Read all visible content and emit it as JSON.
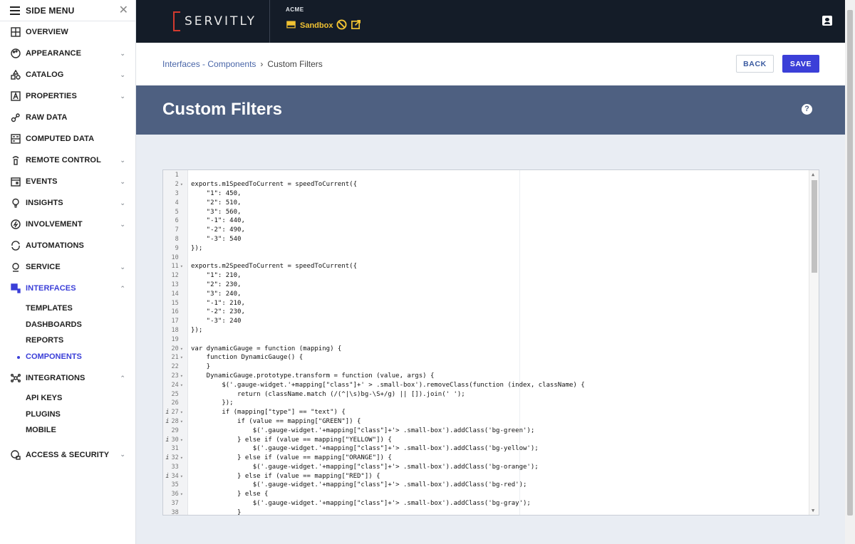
{
  "sidebar": {
    "title": "SIDE MENU",
    "close": "✕",
    "items": [
      {
        "label": "OVERVIEW",
        "chevron": ""
      },
      {
        "label": "APPEARANCE",
        "chevron": "⌄"
      },
      {
        "label": "CATALOG",
        "chevron": "⌄"
      },
      {
        "label": "PROPERTIES",
        "chevron": "⌄"
      },
      {
        "label": "RAW DATA",
        "chevron": ""
      },
      {
        "label": "COMPUTED DATA",
        "chevron": ""
      },
      {
        "label": "REMOTE CONTROL",
        "chevron": "⌄"
      },
      {
        "label": "EVENTS",
        "chevron": "⌄"
      },
      {
        "label": "INSIGHTS",
        "chevron": "⌄"
      },
      {
        "label": "INVOLVEMENT",
        "chevron": "⌄"
      },
      {
        "label": "AUTOMATIONS",
        "chevron": ""
      },
      {
        "label": "SERVICE",
        "chevron": "⌄"
      },
      {
        "label": "INTERFACES",
        "chevron": "⌃"
      },
      {
        "label": "INTEGRATIONS",
        "chevron": "⌃"
      },
      {
        "label": "ACCESS & SECURITY",
        "chevron": "⌄"
      }
    ],
    "interfaces_sub": [
      "TEMPLATES",
      "DASHBOARDS",
      "REPORTS",
      "COMPONENTS"
    ],
    "integrations_sub": [
      "API KEYS",
      "PLUGINS",
      "MOBILE"
    ]
  },
  "topbar": {
    "logo": "SERVITLY",
    "org": "ACME",
    "env": "Sandbox"
  },
  "breadcrumb": {
    "parent": "Interfaces - Components",
    "sep": "›",
    "current": "Custom Filters"
  },
  "buttons": {
    "back": "BACK",
    "save": "SAVE"
  },
  "header": {
    "title": "Custom Filters",
    "help": "?"
  },
  "editor": {
    "lines": [
      {
        "n": "1",
        "t": ""
      },
      {
        "n": "2",
        "f": true,
        "t": "exports.m1SpeedToCurrent = speedToCurrent({"
      },
      {
        "n": "3",
        "t": "    \"1\": 450,"
      },
      {
        "n": "4",
        "t": "    \"2\": 510,"
      },
      {
        "n": "5",
        "t": "    \"3\": 560,"
      },
      {
        "n": "6",
        "t": "    \"-1\": 440,"
      },
      {
        "n": "7",
        "t": "    \"-2\": 490,"
      },
      {
        "n": "8",
        "t": "    \"-3\": 540"
      },
      {
        "n": "9",
        "t": "});"
      },
      {
        "n": "10",
        "t": ""
      },
      {
        "n": "11",
        "f": true,
        "t": "exports.m2SpeedToCurrent = speedToCurrent({"
      },
      {
        "n": "12",
        "t": "    \"1\": 210,"
      },
      {
        "n": "13",
        "t": "    \"2\": 230,"
      },
      {
        "n": "14",
        "t": "    \"3\": 240,"
      },
      {
        "n": "15",
        "t": "    \"-1\": 210,"
      },
      {
        "n": "16",
        "t": "    \"-2\": 230,"
      },
      {
        "n": "17",
        "t": "    \"-3\": 240"
      },
      {
        "n": "18",
        "t": "});"
      },
      {
        "n": "19",
        "t": ""
      },
      {
        "n": "20",
        "f": true,
        "t": "var dynamicGauge = function (mapping) {"
      },
      {
        "n": "21",
        "f": true,
        "t": "    function DynamicGauge() {"
      },
      {
        "n": "22",
        "t": "    }"
      },
      {
        "n": "23",
        "f": true,
        "t": "    DynamicGauge.prototype.transform = function (value, args) {"
      },
      {
        "n": "24",
        "f": true,
        "t": "        $('.gauge-widget.'+mapping[\"class\"]+' > .small-box').removeClass(function (index, className) {"
      },
      {
        "n": "25",
        "t": "            return (className.match (/(^|\\s)bg-\\S+/g) || []).join(' ');"
      },
      {
        "n": "26",
        "t": "        });"
      },
      {
        "n": "27",
        "i": true,
        "f": true,
        "t": "        if (mapping[\"type\"] == \"text\") {"
      },
      {
        "n": "28",
        "i": true,
        "f": true,
        "t": "            if (value == mapping[\"GREEN\"]) {"
      },
      {
        "n": "29",
        "t": "                $('.gauge-widget.'+mapping[\"class\"]+'> .small-box').addClass('bg-green');"
      },
      {
        "n": "30",
        "i": true,
        "f": true,
        "t": "            } else if (value == mapping[\"YELLOW\"]) {"
      },
      {
        "n": "31",
        "t": "                $('.gauge-widget.'+mapping[\"class\"]+'> .small-box').addClass('bg-yellow');"
      },
      {
        "n": "32",
        "i": true,
        "f": true,
        "t": "            } else if (value == mapping[\"ORANGE\"]) {"
      },
      {
        "n": "33",
        "t": "                $('.gauge-widget.'+mapping[\"class\"]+'> .small-box').addClass('bg-orange');"
      },
      {
        "n": "34",
        "i": true,
        "f": true,
        "t": "            } else if (value == mapping[\"RED\"]) {"
      },
      {
        "n": "35",
        "t": "                $('.gauge-widget.'+mapping[\"class\"]+'> .small-box').addClass('bg-red');"
      },
      {
        "n": "36",
        "f": true,
        "t": "            } else {"
      },
      {
        "n": "37",
        "t": "                $('.gauge-widget.'+mapping[\"class\"]+'> .small-box').addClass('bg-gray');"
      },
      {
        "n": "38",
        "t": "            }"
      }
    ]
  },
  "colors": {
    "accent": "#3b3fd8",
    "topbar": "#141c28",
    "band": "#4e6081",
    "env": "#f1c232",
    "logo_bracket": "#d23a2f"
  }
}
